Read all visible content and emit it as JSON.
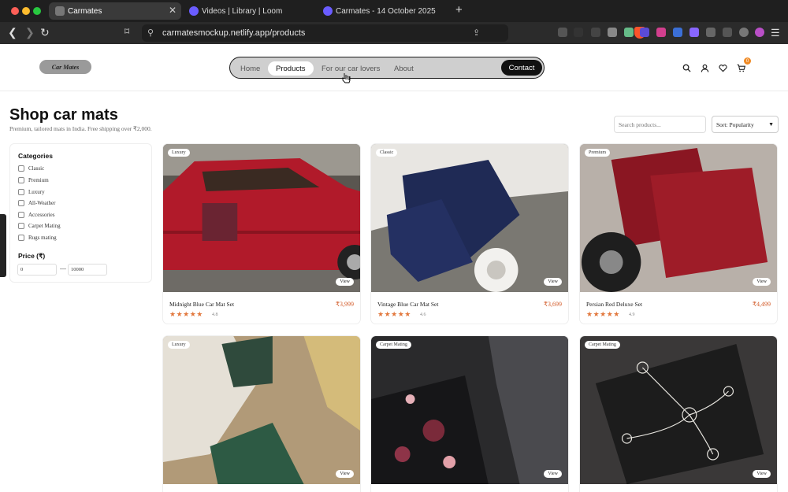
{
  "browser": {
    "tabs": [
      {
        "title": "Carmates",
        "active": true
      },
      {
        "title": "Videos | Library | Loom",
        "active": false
      },
      {
        "title": "Carmates - 14 October 2025",
        "active": false
      }
    ],
    "url": "carmatesmockup.netlify.app/products"
  },
  "site": {
    "logo_text": "Car Mates",
    "nav": {
      "home": "Home",
      "products": "Products",
      "car_lovers": "For our car lovers",
      "about": "About",
      "contact": "Contact"
    },
    "cart_count": "0"
  },
  "page": {
    "title": "Shop car mats",
    "subtitle": "Premium, tailored mats in India. Free shipping over ₹2,000.",
    "search_placeholder": "Search products...",
    "sort_label": "Sort: Popularity"
  },
  "filters": {
    "categories_title": "Categories",
    "categories": [
      "Classic",
      "Premium",
      "Luxury",
      "All-Weather",
      "Accessories",
      "Carpet Mating",
      "Rugs mating"
    ],
    "price_title": "Price (₹)",
    "price_min": "0",
    "price_max": "10000"
  },
  "products": [
    {
      "badge": "Luxury",
      "name": "Midnight Blue Car Mat Set",
      "price": "₹3,999",
      "rating": "4.8",
      "view": "View"
    },
    {
      "badge": "Classic",
      "name": "Vintage Blue Car Mat Set",
      "price": "₹3,699",
      "rating": "4.6",
      "view": "View"
    },
    {
      "badge": "Premium",
      "name": "Persian Red Deluxe Set",
      "price": "₹4,499",
      "rating": "4.9",
      "view": "View"
    },
    {
      "badge": "Luxury",
      "view": "View"
    },
    {
      "badge": "Carpet Mating",
      "view": "View"
    },
    {
      "badge": "Carpet Mating",
      "view": "View"
    }
  ],
  "colors": {
    "accent": "#d35c2a",
    "star": "#e2773c",
    "nav_pill": "#cfcfcf",
    "dark": "#111111"
  }
}
